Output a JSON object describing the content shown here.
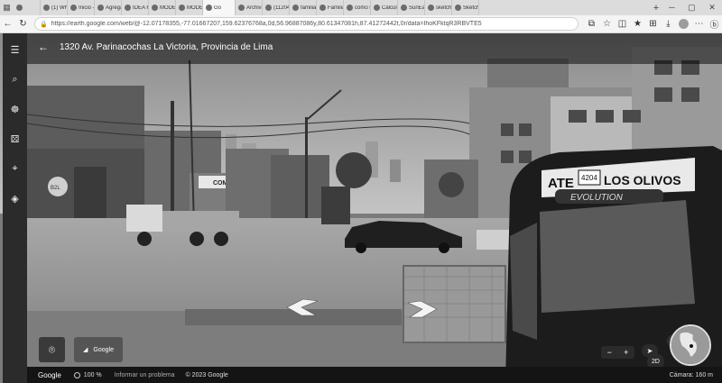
{
  "browser": {
    "tabs": [
      {
        "title": "",
        "active": false
      },
      {
        "title": "(1) Wha",
        "active": false
      },
      {
        "title": "Inicio -",
        "active": false
      },
      {
        "title": "Agrega",
        "active": false
      },
      {
        "title": "IDEA R",
        "active": false
      },
      {
        "title": "MODEL",
        "active": false
      },
      {
        "title": "MODEL",
        "active": false
      },
      {
        "title": "Go",
        "active": true
      },
      {
        "title": "Archivo",
        "active": false
      },
      {
        "title": "(11204",
        "active": false
      },
      {
        "title": "familias",
        "active": false
      },
      {
        "title": "Familia",
        "active": false
      },
      {
        "title": "como h",
        "active": false
      },
      {
        "title": "Cálculo",
        "active": false
      },
      {
        "title": "SunEar",
        "active": false
      },
      {
        "title": "sketch",
        "active": false
      },
      {
        "title": "Sketch",
        "active": false
      }
    ],
    "new_tab": "+",
    "url": "https://earth.google.com/web/@-12.07178355,-77.01667207,159.62376768a,0d,56.96887086y,80.61347081h,87.41272442t,0r/data=IhoKFktqR3RBVTE5",
    "win": {
      "min": "─",
      "max": "▢",
      "close": "✕"
    }
  },
  "earth": {
    "location_title": "1320 Av. Parinacochas La Victoria, Provincia de Lima",
    "card_thumb_label": "Google",
    "bottom": {
      "logo": "Google",
      "zoom": "100 %",
      "report": "Informar un problema",
      "copyright": "© 2023 Google",
      "scale": "Cámara: 160 m"
    },
    "controls": {
      "mode": "2D",
      "zoom_out": "−",
      "zoom_in": "+",
      "compass": "➤"
    },
    "scene_text": {
      "sign_1": "COMERCIAL JUAN",
      "bus_route": "ATE",
      "bus_destination": "LOS OLIVOS",
      "bus_number": "4204",
      "bus_model": "EVOLUTION",
      "store_sign": "B2L"
    }
  }
}
